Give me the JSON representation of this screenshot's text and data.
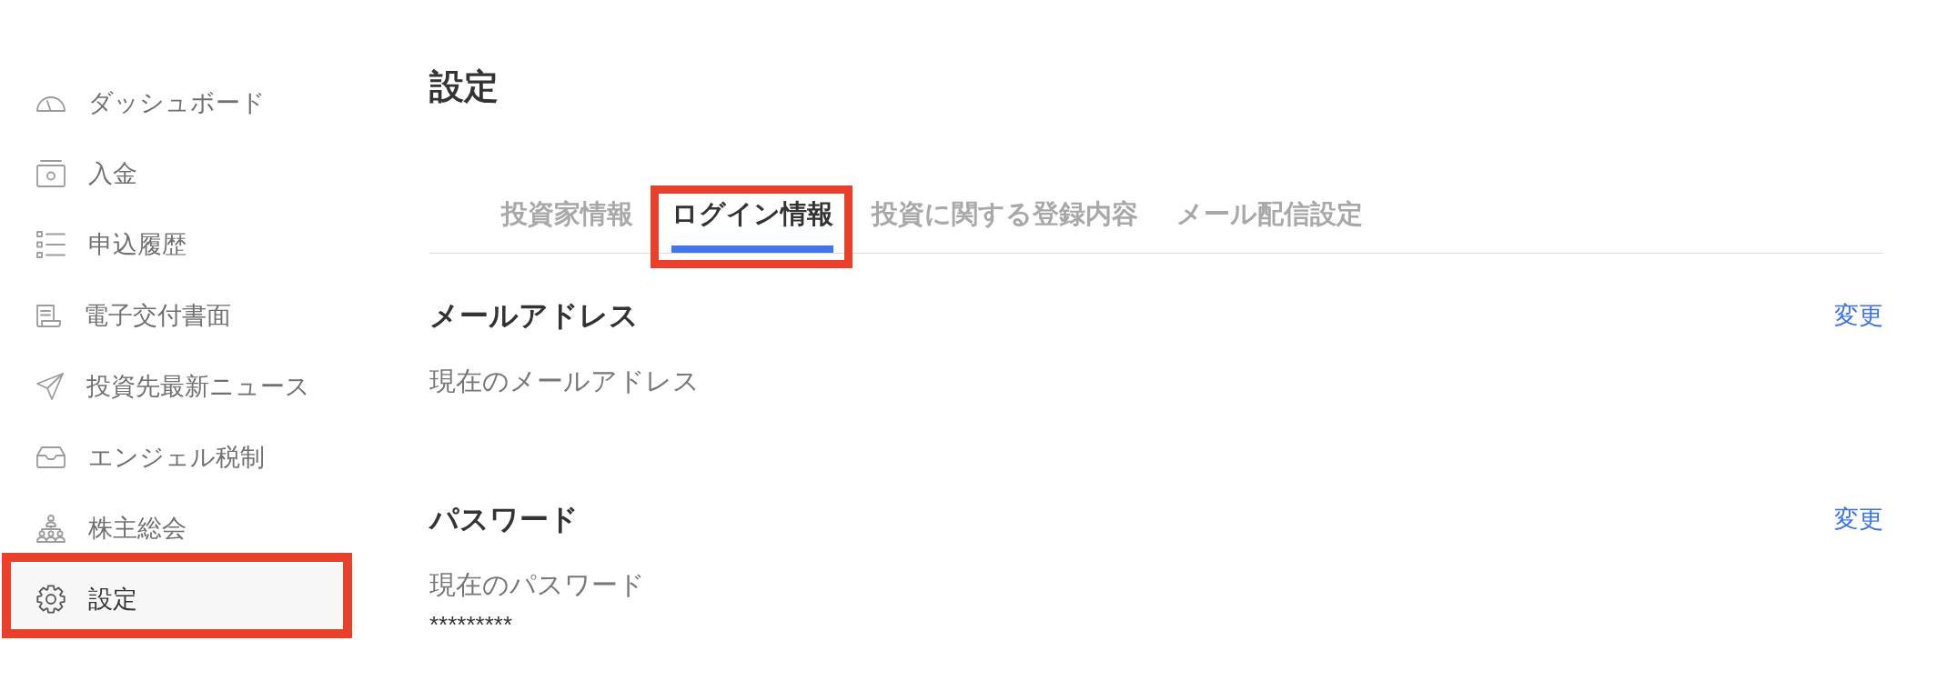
{
  "sidebar": {
    "items": [
      {
        "label": "ダッシュボード",
        "selected": false,
        "highlighted": false
      },
      {
        "label": "入金",
        "selected": false,
        "highlighted": false
      },
      {
        "label": "申込履歴",
        "selected": false,
        "highlighted": false
      },
      {
        "label": "電子交付書面",
        "selected": false,
        "highlighted": false
      },
      {
        "label": "投資先最新ニュース",
        "selected": false,
        "highlighted": false
      },
      {
        "label": "エンジェル税制",
        "selected": false,
        "highlighted": false
      },
      {
        "label": "株主総会",
        "selected": false,
        "highlighted": false
      },
      {
        "label": "設定",
        "selected": true,
        "highlighted": true
      }
    ]
  },
  "page_title": "設定",
  "tabs": [
    {
      "label": "投資家情報",
      "selected": false,
      "highlighted": false
    },
    {
      "label": "ログイン情報",
      "selected": true,
      "highlighted": true
    },
    {
      "label": "投資に関する登録内容",
      "selected": false,
      "highlighted": false
    },
    {
      "label": "メール配信設定",
      "selected": false,
      "highlighted": false
    }
  ],
  "sections": [
    {
      "heading": "メールアドレス",
      "action": "変更",
      "field_label": "現在のメールアドレス"
    },
    {
      "heading": "パスワード",
      "action": "変更",
      "field_label": "現在のパスワード",
      "value": "*********"
    }
  ]
}
